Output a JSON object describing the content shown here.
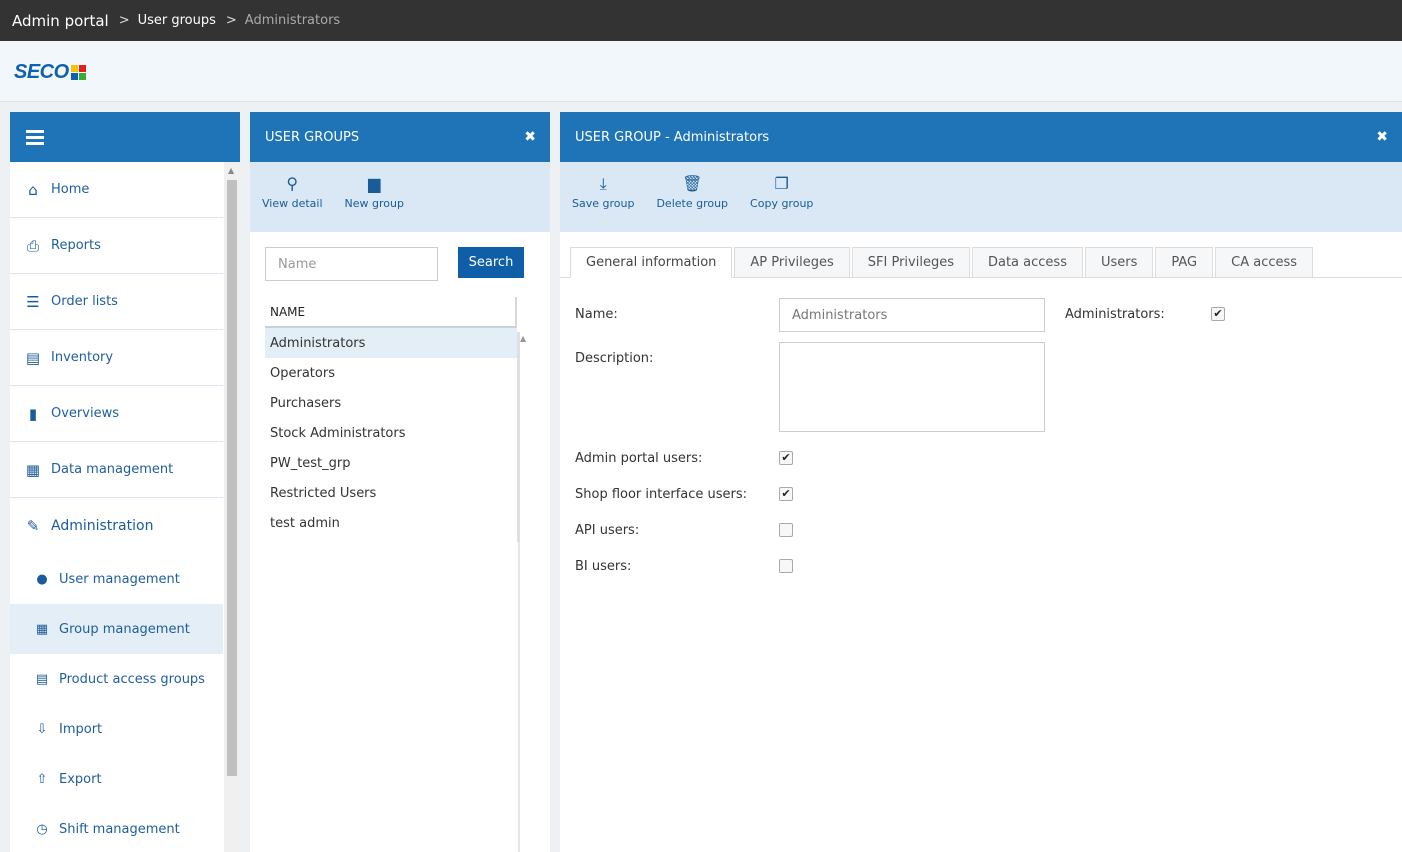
{
  "breadcrumb": {
    "root": "Admin portal",
    "sep1": ">",
    "middle": "User groups",
    "sep2": ">",
    "current": "Administrators"
  },
  "brand": {
    "logo_text": "SECO",
    "colors": [
      "#f5c400",
      "#e2211c",
      "#1060b0",
      "#3aaa35"
    ]
  },
  "sidebar": {
    "items": [
      {
        "label": "Home",
        "icon": "home-icon",
        "glyph": "⌂"
      },
      {
        "label": "Reports",
        "icon": "printer-icon",
        "glyph": "⎙"
      },
      {
        "label": "Order lists",
        "icon": "list-icon",
        "glyph": "☰"
      },
      {
        "label": "Inventory",
        "icon": "inventory-icon",
        "glyph": "▤"
      },
      {
        "label": "Overviews",
        "icon": "bar-chart-icon",
        "glyph": "▮"
      },
      {
        "label": "Data management",
        "icon": "briefcase-icon",
        "glyph": "▦"
      },
      {
        "label": "Administration",
        "icon": "wrench-icon",
        "glyph": "✎"
      }
    ],
    "sub_items": [
      {
        "label": "User management",
        "icon": "user-icon",
        "glyph": "●"
      },
      {
        "label": "Group management",
        "icon": "grid-icon",
        "glyph": "▦"
      },
      {
        "label": "Product access groups",
        "icon": "document-list-icon",
        "glyph": "▤"
      },
      {
        "label": "Import",
        "icon": "import-icon",
        "glyph": "⇩"
      },
      {
        "label": "Export",
        "icon": "export-icon",
        "glyph": "⇧"
      },
      {
        "label": "Shift management",
        "icon": "clock-icon",
        "glyph": "◷"
      }
    ]
  },
  "user_groups": {
    "title": "USER GROUPS",
    "close_glyph": "✖",
    "tools": [
      {
        "label": "View detail",
        "icon": "search-icon",
        "glyph": "⚲"
      },
      {
        "label": "New group",
        "icon": "new-file-icon",
        "glyph": "▆"
      }
    ],
    "search": {
      "placeholder": "Name",
      "button": "Search"
    },
    "column": "NAME",
    "rows": [
      "Administrators",
      "Operators",
      "Purchasers",
      "Stock Administrators",
      "PW_test_grp",
      "Restricted Users",
      "test admin"
    ]
  },
  "group_detail": {
    "title": "USER GROUP - Administrators",
    "close_glyph": "✖",
    "tools": [
      {
        "label": "Save group",
        "icon": "download-icon",
        "glyph": "⤓"
      },
      {
        "label": "Delete group",
        "icon": "trash-icon",
        "glyph": "🗑"
      },
      {
        "label": "Copy group",
        "icon": "copy-icon",
        "glyph": "❐"
      }
    ],
    "tabs": [
      "General information",
      "AP Privileges",
      "SFI Privileges",
      "Data access",
      "Users",
      "PAG",
      "CA access"
    ],
    "form": {
      "name_label": "Name:",
      "name_value": "Administrators",
      "description_label": "Description:",
      "description_value": "",
      "administrators_label": "Administrators:",
      "administrators_checked": true,
      "checkboxes": [
        {
          "label": "Admin portal users:",
          "checked": true
        },
        {
          "label": "Shop floor interface users:",
          "checked": true
        },
        {
          "label": "API users:",
          "checked": false
        },
        {
          "label": "BI users:",
          "checked": false
        }
      ]
    }
  }
}
